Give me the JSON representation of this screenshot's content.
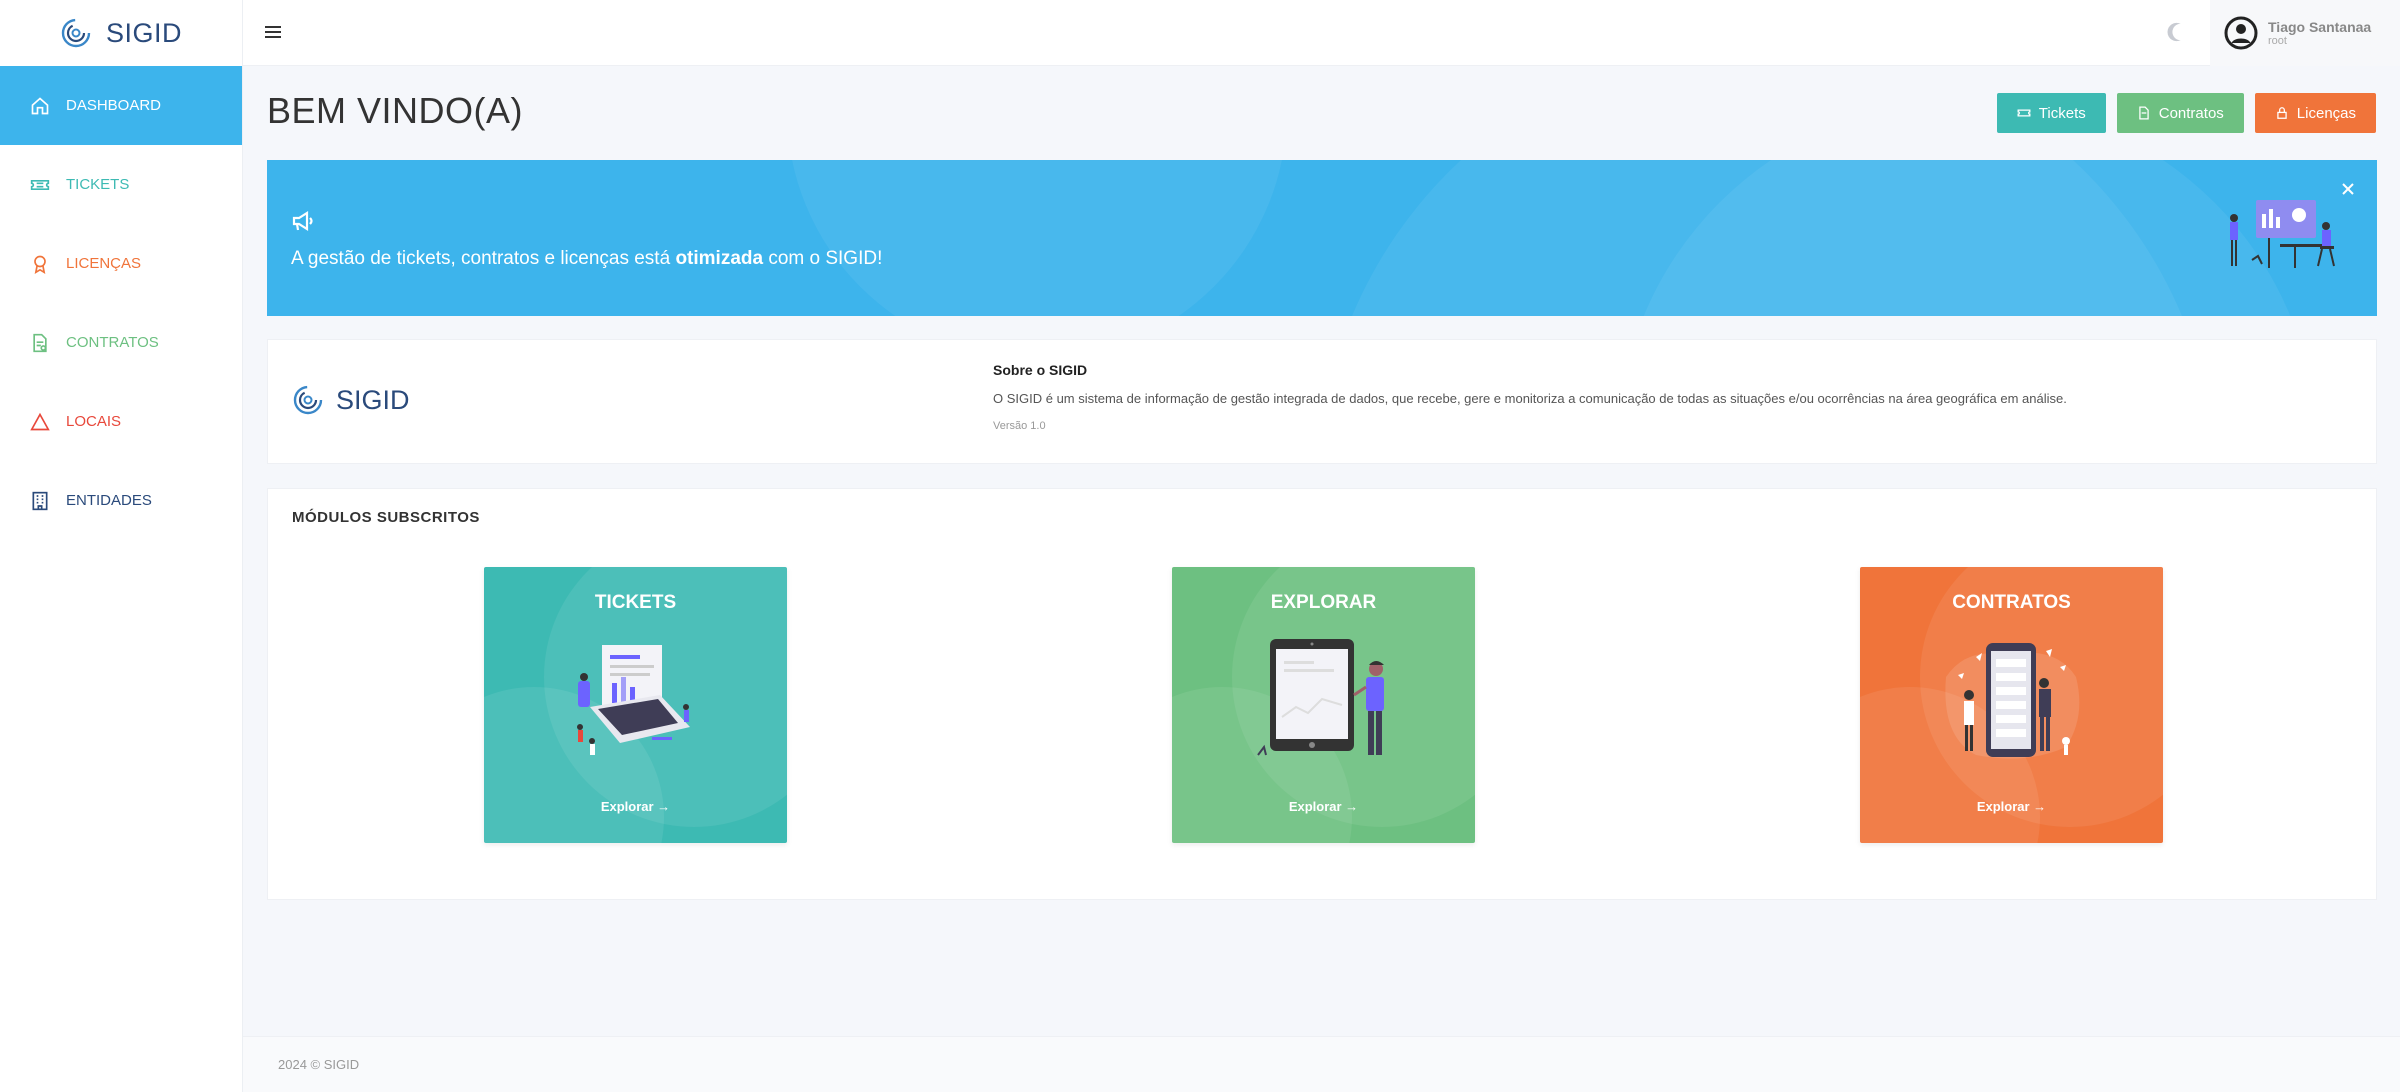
{
  "app": {
    "brand": "SIGID"
  },
  "sidebar": {
    "items": [
      {
        "label": "DASHBOARD",
        "icon": "home-icon",
        "color": "#ffffff",
        "active": true
      },
      {
        "label": "TICKETS",
        "icon": "ticket-icon",
        "color": "#3dbab3",
        "active": false
      },
      {
        "label": "LICENÇAS",
        "icon": "award-icon",
        "color": "#f0743a",
        "active": false
      },
      {
        "label": "CONTRATOS",
        "icon": "document-icon",
        "color": "#6dc081",
        "active": false
      },
      {
        "label": "LOCAIS",
        "icon": "triangle-icon",
        "color": "#e8483b",
        "active": false
      },
      {
        "label": "ENTIDADES",
        "icon": "building-icon",
        "color": "#2a4a7b",
        "active": false
      }
    ]
  },
  "topbar": {
    "user": {
      "name": "Tiago Santanaa",
      "role": "root"
    }
  },
  "page": {
    "title": "BEM VINDO(A)",
    "buttons": [
      {
        "label": "Tickets",
        "icon": "ticket-icon",
        "color": "#3dbab3"
      },
      {
        "label": "Contratos",
        "icon": "document-icon",
        "color": "#6dc081"
      },
      {
        "label": "Licenças",
        "icon": "lock-icon",
        "color": "#f0743a"
      }
    ]
  },
  "banner": {
    "text_before": "A gestão de tickets, contratos e licenças está ",
    "text_bold": "otimizada",
    "text_after": " com o SIGID!",
    "color": "#3db4ec"
  },
  "about": {
    "logo_text": "SIGID",
    "title": "Sobre o SIGID",
    "description": "O SIGID é um sistema de informação de gestão integrada de dados, que recebe, gere e monitoriza a comunicação de todas as situações e/ou ocorrências na área geográfica em análise.",
    "version": "Versão 1.0"
  },
  "modules": {
    "title": "MÓDULOS SUBSCRITOS",
    "cards": [
      {
        "title": "TICKETS",
        "link": "Explorar →",
        "color": "#3dbab3"
      },
      {
        "title": "EXPLORAR",
        "link": "Explorar →",
        "color": "#6dc081"
      },
      {
        "title": "CONTRATOS",
        "link": "Explorar →",
        "color": "#f0743a"
      }
    ]
  },
  "footer": {
    "text": "2024 © SIGID"
  }
}
